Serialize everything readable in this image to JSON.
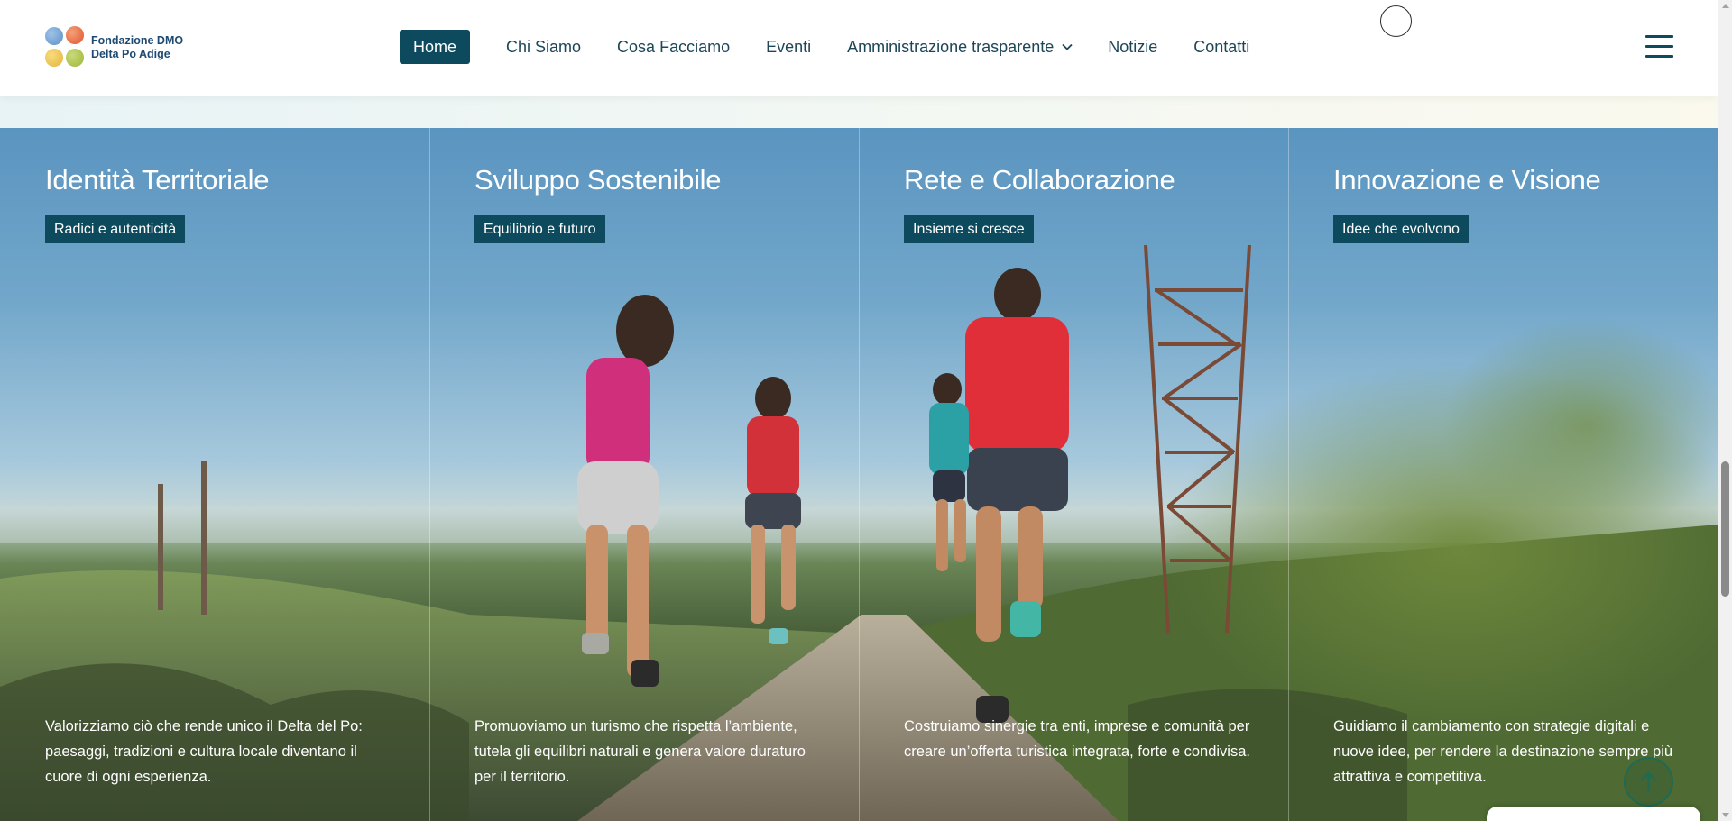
{
  "header": {
    "logo": {
      "line1": "Fondazione DMO",
      "line2": "Delta Po Adige"
    },
    "nav": {
      "home": "Home",
      "chi_siamo": "Chi Siamo",
      "cosa_facciamo": "Cosa Facciamo",
      "eventi": "Eventi",
      "amministrazione": "Amministrazione trasparente",
      "notizie": "Notizie",
      "contatti": "Contatti"
    },
    "icons": {
      "search": "search-icon",
      "menu": "hamburger-menu-icon",
      "dropdown": "chevron-down-icon"
    }
  },
  "hero": {
    "columns": [
      {
        "title": "Identità Territoriale",
        "tag": "Radici e autenticità",
        "description": "Valorizziamo ciò che rende unico il Delta del Po: paesaggi, tradizioni e cultura locale diventano il cuore di ogni esperienza."
      },
      {
        "title": "Sviluppo Sostenibile",
        "tag": "Equilibrio e futuro",
        "description": "Promuoviamo un turismo che rispetta l’ambiente, tutela gli equilibri naturali e genera valore duraturo per il territorio."
      },
      {
        "title": "Rete e Collaborazione",
        "tag": "Insieme si cresce",
        "description": "Costruiamo sinergie tra enti, imprese e comunità per creare un’offerta turistica integrata, forte e condivisa."
      },
      {
        "title": "Innovazione e Visione",
        "tag": "Idee che evolvono",
        "description": "Guidiamo il cambiamento con strategie digitali e nuove idee, per rendere la destinazione sempre più attrattiva e competitiva."
      }
    ]
  },
  "colors": {
    "accent": "#0d4a5e",
    "nav_text": "#1d4657",
    "white": "#ffffff"
  },
  "widgets": {
    "scroll_top": "arrow-up-icon"
  }
}
